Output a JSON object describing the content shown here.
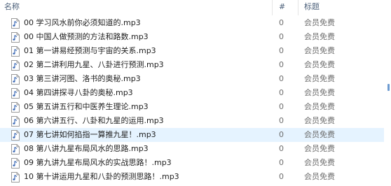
{
  "columns": {
    "name": "名称",
    "number": "#",
    "title": "标题"
  },
  "files": [
    {
      "name": "00 学习风水前你必须知道的.mp3",
      "number": "0",
      "title": "会员免费"
    },
    {
      "name": "00 中国人做预测的方法和路数.mp3",
      "number": "0",
      "title": "会员免费"
    },
    {
      "name": "01 第一讲易经预测与宇宙的关系.mp3",
      "number": "0",
      "title": "会员免费"
    },
    {
      "name": "02 第二讲利用九星、八卦进行预测.mp3",
      "number": "0",
      "title": "会员免费"
    },
    {
      "name": "03 第三讲河图、洛书的奥秘.mp3",
      "number": "0",
      "title": "会员免费"
    },
    {
      "name": "04 第四讲探寻八卦的奥秘.mp3",
      "number": "0",
      "title": "会员免费"
    },
    {
      "name": "05 第五讲五行和中医养生理论.mp3",
      "number": "0",
      "title": "会员免费"
    },
    {
      "name": "06 第六讲五行、八卦和九星的运用.mp3",
      "number": "0",
      "title": "会员免费"
    },
    {
      "name": "07 第七讲如何掐指一算推九星！.mp3",
      "number": "0",
      "title": "会员免费"
    },
    {
      "name": "08 第八讲九星布局风水的思路.mp3",
      "number": "0",
      "title": "会员免费"
    },
    {
      "name": "09 第九讲九星布局风水的实战思路！.mp3",
      "number": "0",
      "title": "会员免费"
    },
    {
      "name": "10 第十讲运用九星和八卦的预测思路！.mp3",
      "number": "0",
      "title": "会员免费"
    }
  ],
  "selected_index": 8,
  "file_icon": "audio-file-icon",
  "colors": {
    "header_text": "#4c607a",
    "selection": "#e5f3ff",
    "muted_text": "#6d6d6d",
    "note_icon": "#3a68b5"
  }
}
